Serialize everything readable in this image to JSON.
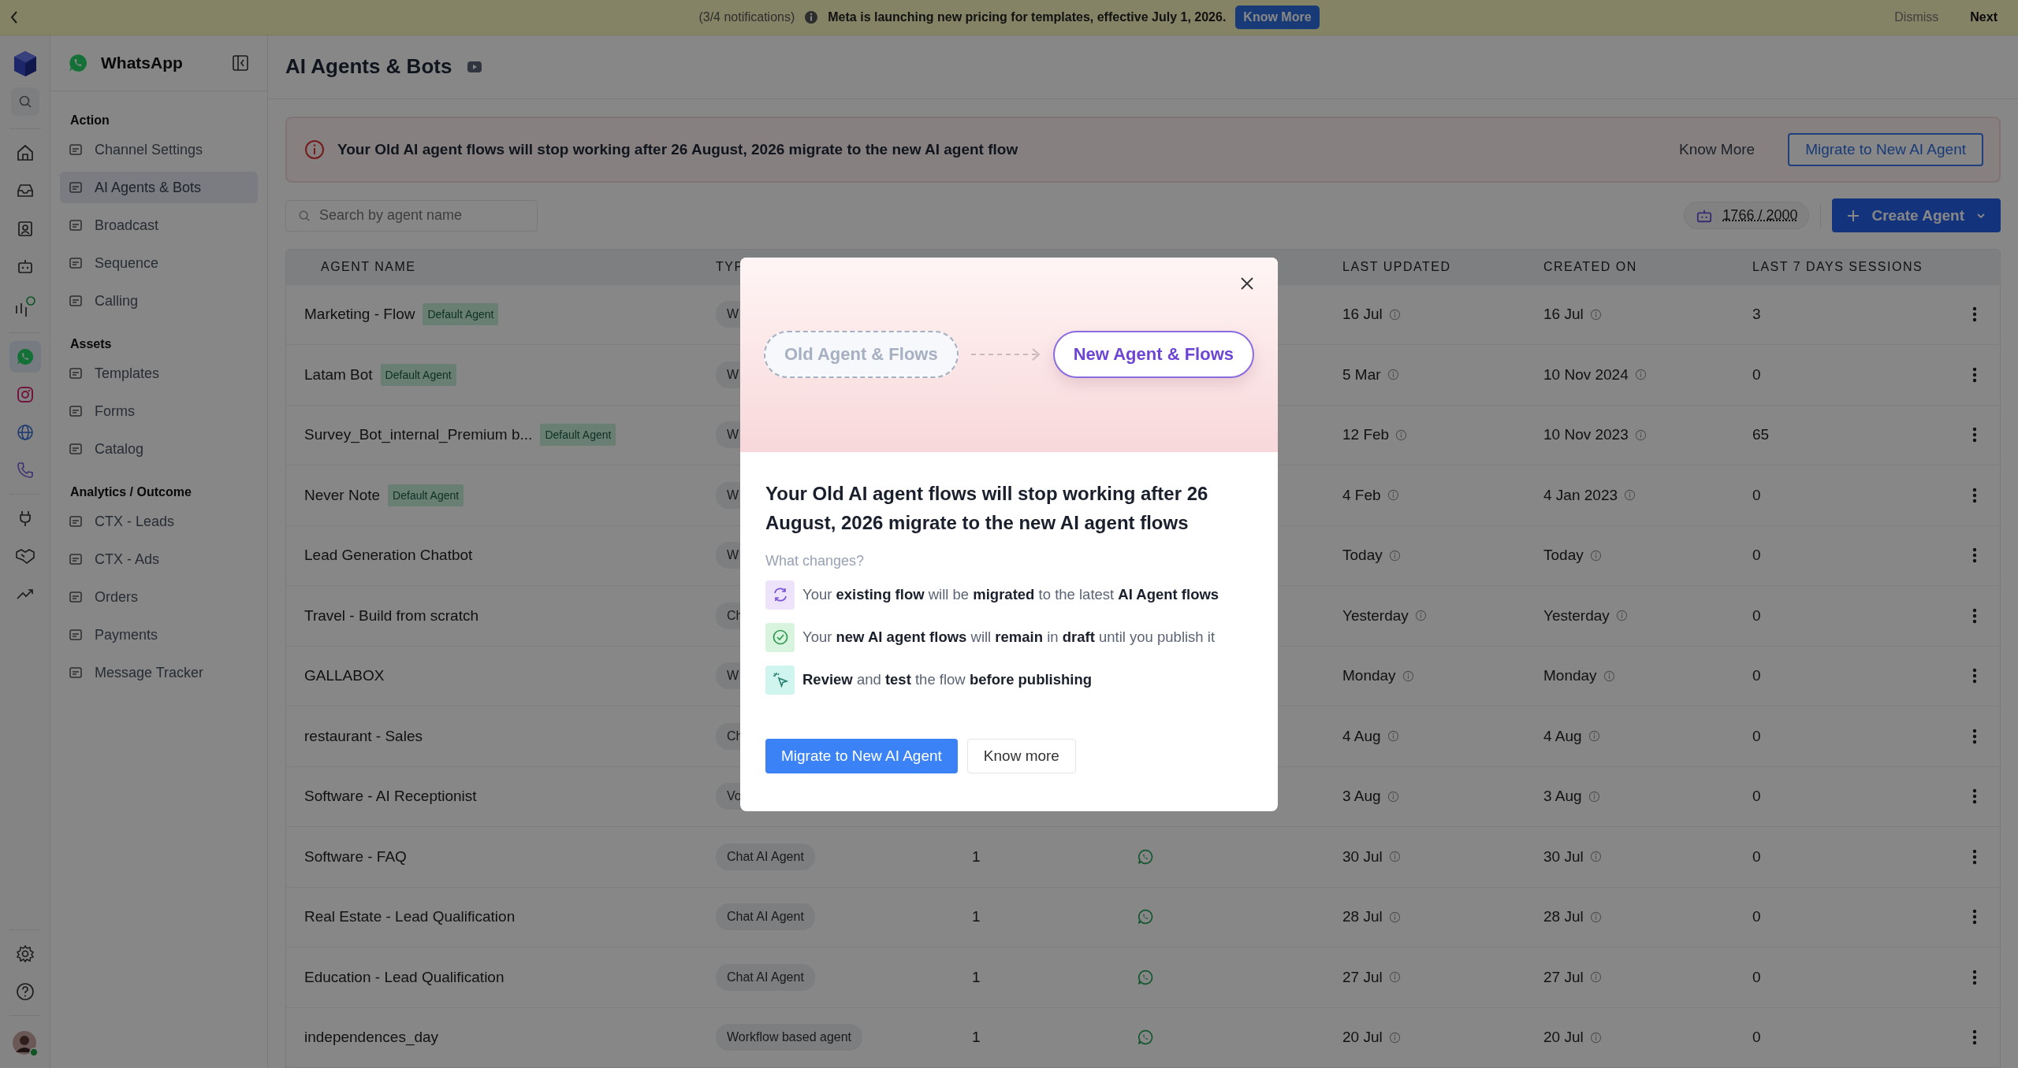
{
  "notification_bar": {
    "count": "(3/4 notifications)",
    "message": "Meta is launching new pricing for templates, effective July 1, 2026.",
    "button": "Know More",
    "dismiss": "Dismiss",
    "next": "Next"
  },
  "rail": {
    "channels": [
      {
        "selected": true
      },
      {
        "selected": false
      },
      {
        "selected": false
      },
      {
        "selected": false
      }
    ]
  },
  "sidebar": {
    "title": "WhatsApp",
    "sections": [
      {
        "heading": "Action",
        "items": [
          {
            "label": "Channel Settings",
            "selected": false
          },
          {
            "label": "AI Agents & Bots",
            "selected": true
          },
          {
            "label": "Broadcast",
            "selected": false
          },
          {
            "label": "Sequence",
            "selected": false
          },
          {
            "label": "Calling",
            "selected": false
          }
        ]
      },
      {
        "heading": "Assets",
        "items": [
          {
            "label": "Templates",
            "selected": false
          },
          {
            "label": "Forms",
            "selected": false
          },
          {
            "label": "Catalog",
            "selected": false
          }
        ]
      },
      {
        "heading": "Analytics / Outcome",
        "items": [
          {
            "label": "CTX - Leads",
            "selected": false
          },
          {
            "label": "CTX - Ads",
            "selected": false
          },
          {
            "label": "Orders",
            "selected": false
          },
          {
            "label": "Payments",
            "selected": false
          },
          {
            "label": "Message Tracker",
            "selected": false
          }
        ]
      }
    ]
  },
  "page": {
    "title": "AI Agents & Bots"
  },
  "alert": {
    "message": "Your Old AI agent flows will stop working after 26 August, 2026 migrate to the new AI agent flow",
    "link": "Know More",
    "button": "Migrate to New AI Agent"
  },
  "toolbar": {
    "search_placeholder": "Search by agent name",
    "usage": "1766 / 2000",
    "create_button": "Create Agent"
  },
  "table": {
    "columns": [
      "AGENT NAME",
      "TYP",
      "LAST UPDATED",
      "CREATED ON",
      "LAST 7 DAYS SESSIONS"
    ],
    "rows": [
      {
        "name": "Marketing - Flow",
        "badge": "Default Agent",
        "type": "W",
        "last_updated": "16 Jul",
        "created_on": "16 Jul",
        "sessions": "3"
      },
      {
        "name": "Latam Bot",
        "badge": "Default Agent",
        "type": "W",
        "last_updated": "5 Mar",
        "created_on": "10 Nov 2024",
        "sessions": "0"
      },
      {
        "name": "Survey_Bot_internal_Premium b...",
        "badge": "Default Agent",
        "type": "W",
        "last_updated": "12 Feb",
        "created_on": "10 Nov 2023",
        "sessions": "65"
      },
      {
        "name": "Never Note",
        "badge": "Default Agent",
        "type": "W",
        "last_updated": "4 Feb",
        "created_on": "4 Jan 2023",
        "sessions": "0"
      },
      {
        "name": "Lead Generation Chatbot",
        "type": "W",
        "last_updated": "Today",
        "created_on": "Today",
        "sessions": "0"
      },
      {
        "name": "Travel - Build from scratch",
        "type": "Ch",
        "last_updated": "Yesterday",
        "created_on": "Yesterday",
        "sessions": "0"
      },
      {
        "name": "GALLABOX",
        "type": "W",
        "last_updated": "Monday",
        "created_on": "Monday",
        "sessions": "0"
      },
      {
        "name": "restaurant - Sales",
        "type": "Ch",
        "last_updated": "4 Aug",
        "created_on": "4 Aug",
        "sessions": "0"
      },
      {
        "name": "Software - AI Receptionist",
        "type": "Vo",
        "last_updated": "3 Aug",
        "created_on": "3 Aug",
        "sessions": "0"
      },
      {
        "name": "Software - FAQ",
        "type": "Chat AI Agent",
        "column_3": "1",
        "last_updated": "30 Jul",
        "created_on": "30 Jul",
        "sessions": "0"
      },
      {
        "name": "Real Estate - Lead Qualification",
        "type": "Chat AI Agent",
        "column_3": "1",
        "last_updated": "28 Jul",
        "created_on": "28 Jul",
        "sessions": "0"
      },
      {
        "name": "Education - Lead Qualification",
        "type": "Chat AI Agent",
        "column_3": "1",
        "last_updated": "27 Jul",
        "created_on": "27 Jul",
        "sessions": "0"
      },
      {
        "name": "independences_day",
        "type": "Workflow based agent",
        "column_3": "1",
        "last_updated": "20 Jul",
        "created_on": "20 Jul",
        "sessions": "0"
      }
    ]
  },
  "modal": {
    "old_step": "Old Agent & Flows",
    "new_step": "New Agent & Flows",
    "title": "Your Old AI agent flows will stop working after 26 August, 2026 migrate to the new AI agent flows",
    "subheading": "What changes?",
    "changes": [
      {
        "text": "Your **existing flow** will be **migrated** to the latest **AI Agent flows**",
        "color": "#ede3fb"
      },
      {
        "text": "Your **new AI agent flows** will **remain** in **draft** until you publish it",
        "color": "#d8f3de"
      },
      {
        "text": "**Review** and **test** the flow **before publishing**",
        "color": "#cff5ee"
      }
    ],
    "primary_button": "Migrate to New AI Agent",
    "secondary_button": "Know more"
  }
}
